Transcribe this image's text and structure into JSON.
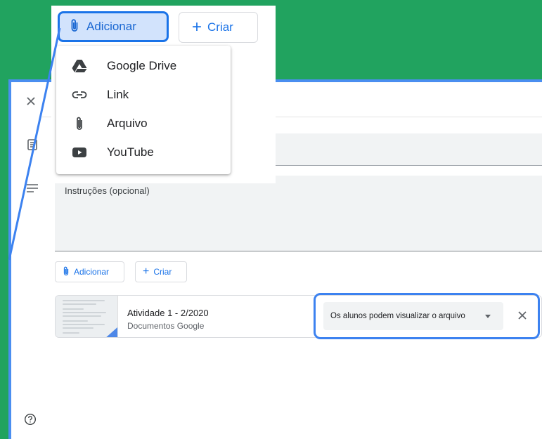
{
  "toolbar": {
    "add_label": "Adicionar",
    "create_label": "Criar"
  },
  "add_menu": {
    "items": [
      {
        "label": "Google Drive",
        "icon": "google-drive-icon"
      },
      {
        "label": "Link",
        "icon": "link-icon"
      },
      {
        "label": "Arquivo",
        "icon": "paperclip-icon"
      },
      {
        "label": "YouTube",
        "icon": "youtube-icon"
      }
    ]
  },
  "form": {
    "instructions_placeholder": "Instruções (opcional)",
    "add_label": "Adicionar",
    "create_label": "Criar"
  },
  "attachment": {
    "title": "Atividade 1 - 2/2020",
    "type": "Documentos Google",
    "permission": "Os alunos podem visualizar o arquivo"
  },
  "colors": {
    "background_green": "#21a35f",
    "accent_blue": "#1a73e8",
    "highlight_blue": "#3c82f0"
  }
}
